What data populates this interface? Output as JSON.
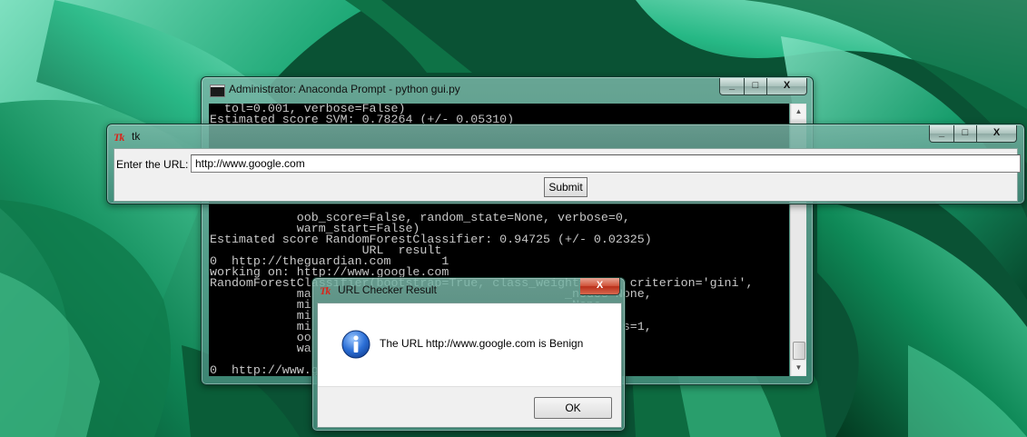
{
  "console": {
    "title": "Administrator: Anaconda Prompt - python  gui.py",
    "lines": [
      "  tol=0.001, verbose=False)",
      "Estimated score SVM: 0.78264 (+/- 0.05310)",
      "",
      "",
      "",
      "",
      "",
      "",
      "",
      "",
      "            oob_score=False, random_state=None, verbose=0,",
      "            warm_start=False)",
      "Estimated score RandomForestClassifier: 0.94725 (+/- 0.02325)",
      "                     URL  result",
      "0  http://theguardian.com       1",
      "working on: http://www.google.com",
      "RandomForestClassifier(bootstrap=True, class_weight=None, criterion='gini',",
      "            ma                                   _nodes=None,",
      "            mi                                   =None,",
      "            mi",
      "            mi                                   0, n_jobs=1,",
      "            oo",
      "            wa",
      "",
      "0  http://www.g"
    ]
  },
  "tk": {
    "title": "tk",
    "url_label": "Enter the URL:",
    "url_value": "http://www.google.com",
    "submit_label": "Submit"
  },
  "dialog": {
    "title": "URL Checker Result",
    "message": "The URL http://www.google.com is Benign",
    "ok_label": "OK"
  },
  "window_controls": {
    "close_glyph": "X",
    "maximize_glyph": "□",
    "minimize_glyph": "_"
  },
  "colors": {
    "console_bg": "#000000",
    "console_text": "#c8c8c8",
    "close_red": "#c13a22"
  }
}
